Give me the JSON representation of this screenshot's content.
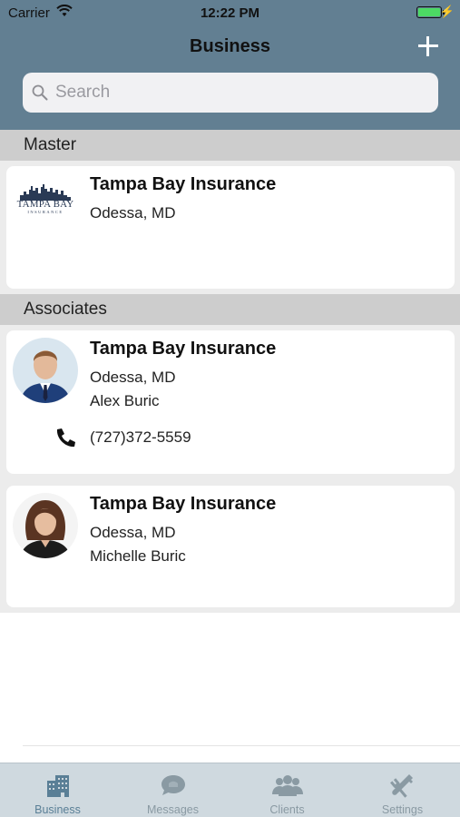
{
  "status_bar": {
    "carrier": "Carrier",
    "time": "12:22 PM"
  },
  "nav": {
    "title": "Business",
    "add_icon": "plus-icon"
  },
  "search": {
    "placeholder": "Search",
    "value": ""
  },
  "sections": {
    "master": {
      "header": "Master",
      "items": [
        {
          "title": "Tampa Bay Insurance",
          "location": "Odessa, MD",
          "logo_text": "TAMPA BAY",
          "logo_subtext": "INSURANCE"
        }
      ]
    },
    "associates": {
      "header": "Associates",
      "items": [
        {
          "title": "Tampa Bay Insurance",
          "location": "Odessa, MD",
          "name": "Alex Buric",
          "phone": "(727)372-5559"
        },
        {
          "title": "Tampa Bay Insurance",
          "location": "Odessa, MD",
          "name": "Michelle Buric"
        }
      ]
    }
  },
  "tabs": [
    {
      "label": "Business",
      "icon": "building-icon",
      "active": true
    },
    {
      "label": "Messages",
      "icon": "chat-bubble-icon",
      "active": false
    },
    {
      "label": "Clients",
      "icon": "people-icon",
      "active": false
    },
    {
      "label": "Settings",
      "icon": "tools-icon",
      "active": false
    }
  ],
  "colors": {
    "header_bg": "#627f92",
    "tab_active": "#5a7f96",
    "tab_inactive": "#8a9aa3",
    "battery": "#4cd964"
  }
}
